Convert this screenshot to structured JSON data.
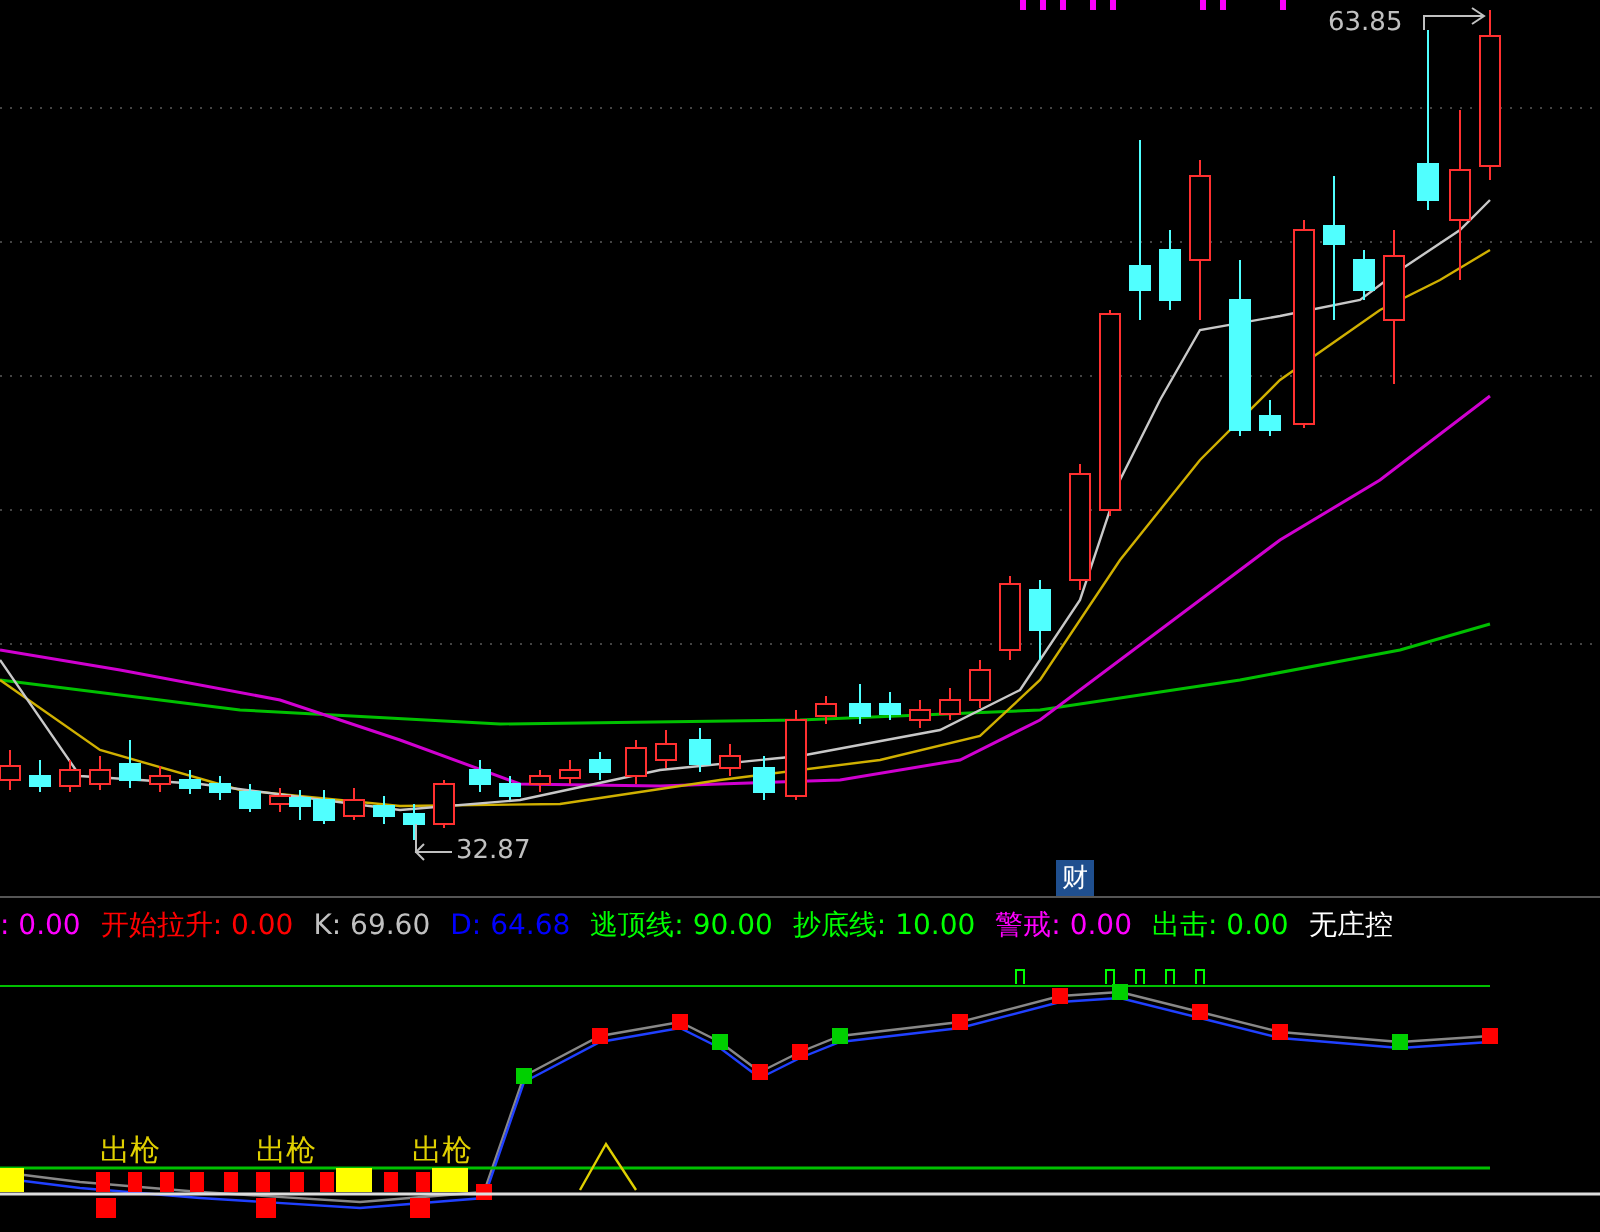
{
  "price_labels": [
    {
      "text": "63.85",
      "kind": "high"
    },
    {
      "text": "32.87",
      "kind": "low"
    }
  ],
  "badge": "财",
  "legend": [
    {
      "text": ": 0.00",
      "color": "#ff00ff"
    },
    {
      "text": "开始拉升: 0.00",
      "color": "#ff0000"
    },
    {
      "text": "K: 69.60",
      "color": "#c0c0c0"
    },
    {
      "text": "D: 64.68",
      "color": "#0000ff"
    },
    {
      "text": "逃顶线: 90.00",
      "color": "#00ff00"
    },
    {
      "text": "抄底线: 10.00",
      "color": "#00ff00"
    },
    {
      "text": "警戒: 0.00",
      "color": "#ff00ff"
    },
    {
      "text": "出击: 0.00",
      "color": "#00ff00"
    },
    {
      "text": "无庄控",
      "color": "#ffffff"
    }
  ],
  "signals": [
    "出枪",
    "出枪",
    "出枪"
  ]
}
